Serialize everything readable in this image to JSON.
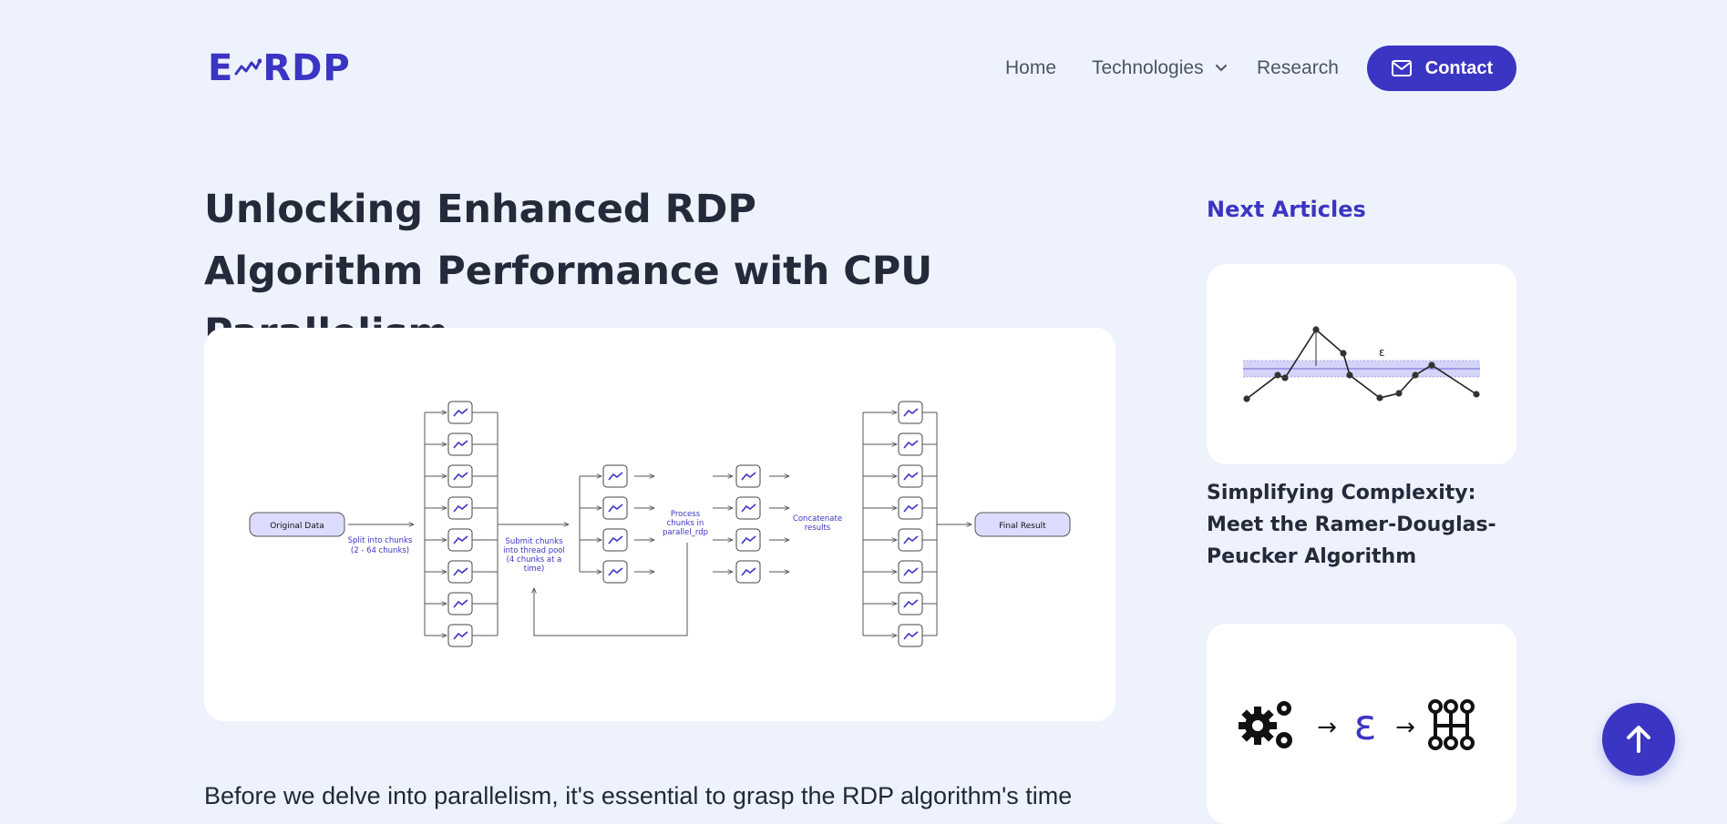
{
  "header": {
    "logo_left": "E",
    "logo_right": "RDP",
    "nav": {
      "home": "Home",
      "technologies": "Technologies",
      "research": "Research",
      "contact": "Contact"
    },
    "icons": {
      "dropdown": "chevron-down-icon",
      "contact": "mail-icon"
    }
  },
  "article": {
    "title": "Unlocking Enhanced RDP Algorithm Performance with CPU Parallelism",
    "figure": {
      "original_data": "Original Data",
      "split_label_1": "Split into chunks",
      "split_label_2": "(2 - 64 chunks)",
      "submit_label_1": "Submit chunks",
      "submit_label_2": "into thread pool",
      "submit_label_3": "(4 chunks at a",
      "submit_label_4": "time)",
      "process_label_1": "Process",
      "process_label_2": "chunks in",
      "process_label_3": "parallel_rdp",
      "concat_label_1": "Concatenate",
      "concat_label_2": "results",
      "final_result": "Final Result"
    },
    "body_text": "Before we delve into parallelism, it's essential to grasp the RDP algorithm's time"
  },
  "sidebar": {
    "heading": "Next Articles",
    "articles": [
      {
        "title": "Simplifying Complexity: Meet the Ramer-Douglas-Peucker Algorithm",
        "epsilon_label": "ε"
      },
      {
        "title": "",
        "epsilon_symbol": "ε"
      }
    ]
  },
  "colors": {
    "accent": "#3b35c3",
    "background": "#eef2fd",
    "card": "#ffffff",
    "text_dark": "#252a3a"
  },
  "back_to_top_icon": "arrow-up-icon"
}
